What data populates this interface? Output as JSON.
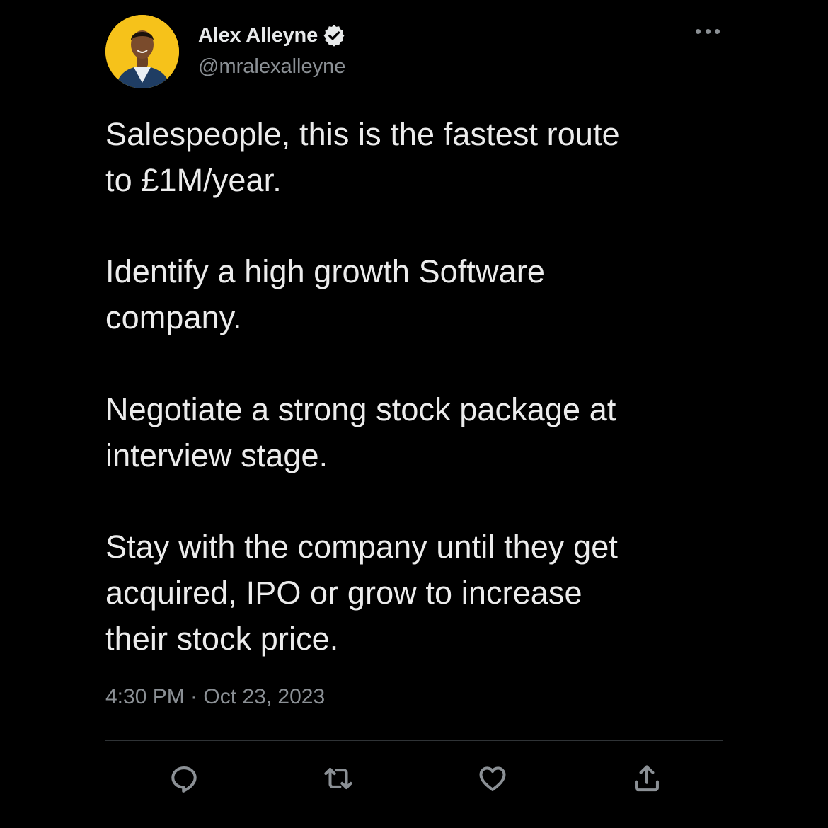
{
  "author": {
    "name": "Alex Alleyne",
    "handle": "@mralexalleyne",
    "verified_icon": "verified-badge-icon",
    "avatar_background_color": "#f6c21a"
  },
  "tweet": {
    "paragraphs": [
      "Salespeople, this is the fastest route\nto £1M/year.",
      "Identify a high growth Software\ncompany.",
      "Negotiate a strong stock package at\ninterview stage.",
      "Stay with the company until they get\nacquired, IPO or grow to increase\ntheir stock price."
    ],
    "timestamp": "4:30 PM · Oct 23, 2023"
  },
  "actions": [
    {
      "name": "reply",
      "icon": "reply-icon"
    },
    {
      "name": "retweet",
      "icon": "retweet-icon"
    },
    {
      "name": "like",
      "icon": "like-icon"
    },
    {
      "name": "share",
      "icon": "share-icon"
    }
  ],
  "colors": {
    "background": "#000000",
    "text_primary": "#e7e9ea",
    "text_secondary": "#8b9095",
    "divider": "#2f3336"
  }
}
